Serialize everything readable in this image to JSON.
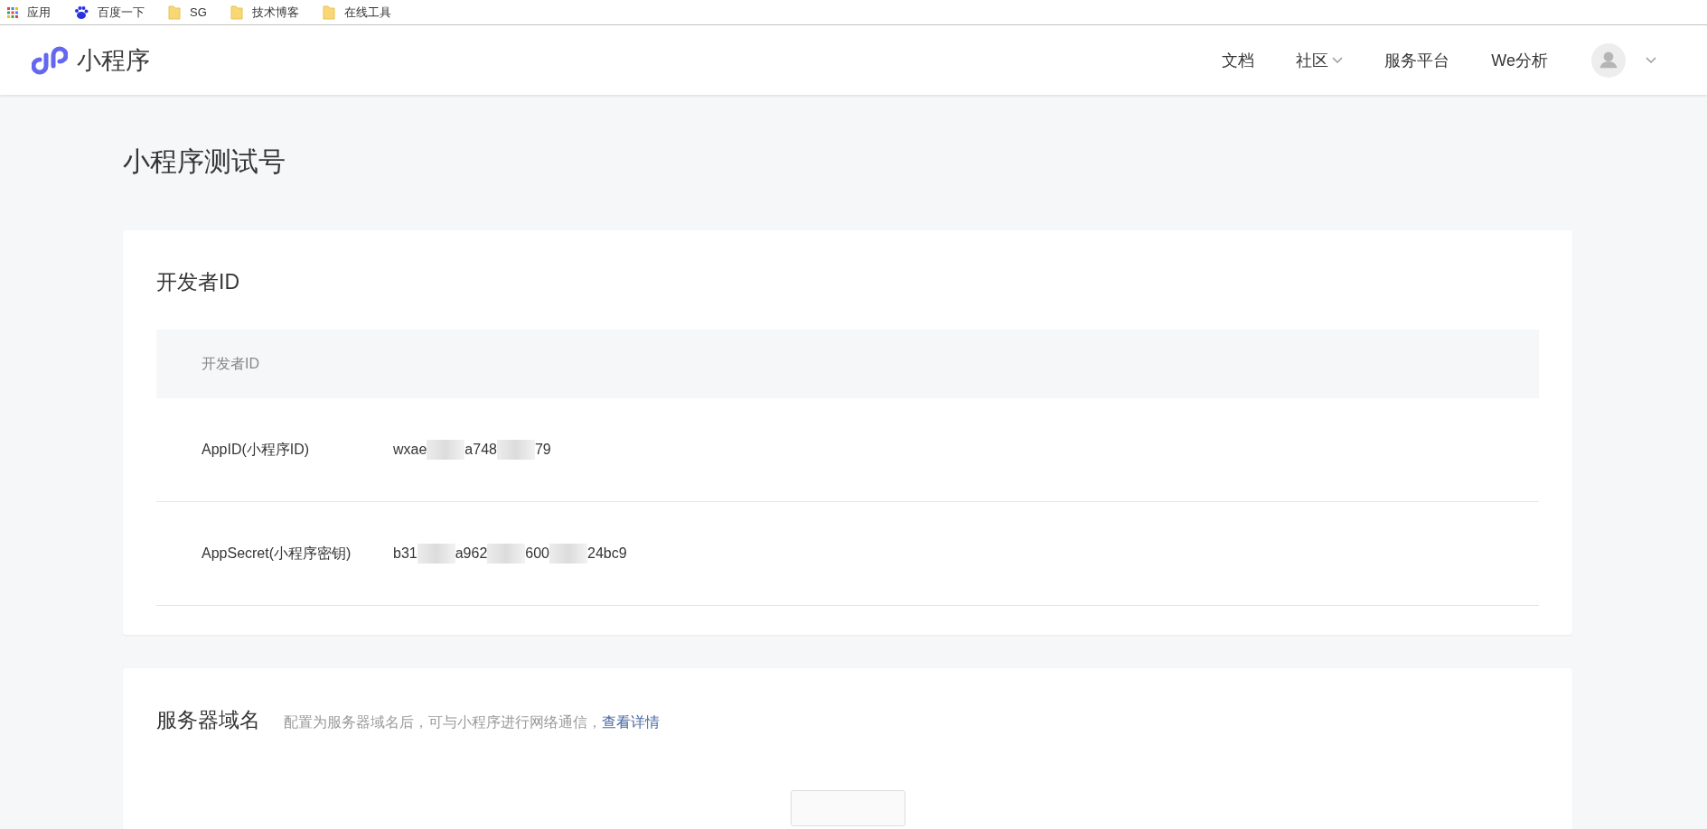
{
  "bookmarks": [
    {
      "kind": "apps",
      "label": "应用"
    },
    {
      "kind": "paw",
      "label": "百度一下"
    },
    {
      "kind": "folder",
      "label": "SG"
    },
    {
      "kind": "folder",
      "label": "技术博客"
    },
    {
      "kind": "folder",
      "label": "在线工具"
    }
  ],
  "header": {
    "brand": "小程序",
    "nav": [
      {
        "label": "文档",
        "dropdown": false
      },
      {
        "label": "社区",
        "dropdown": true
      },
      {
        "label": "服务平台",
        "dropdown": false
      },
      {
        "label": "We分析",
        "dropdown": false
      }
    ]
  },
  "page_title": "小程序测试号",
  "developer_card": {
    "title": "开发者ID",
    "table_header": "开发者ID",
    "rows": [
      {
        "label": "AppID(小程序ID)",
        "value_parts": [
          "wxae",
          "a748",
          "79"
        ]
      },
      {
        "label": "AppSecret(小程序密钥)",
        "value_parts": [
          "b31",
          "a962",
          "600",
          "24bc9"
        ]
      }
    ]
  },
  "server_card": {
    "title": "服务器域名",
    "description": "配置为服务器域名后，可与小程序进行网络通信，",
    "link": "查看详情"
  }
}
